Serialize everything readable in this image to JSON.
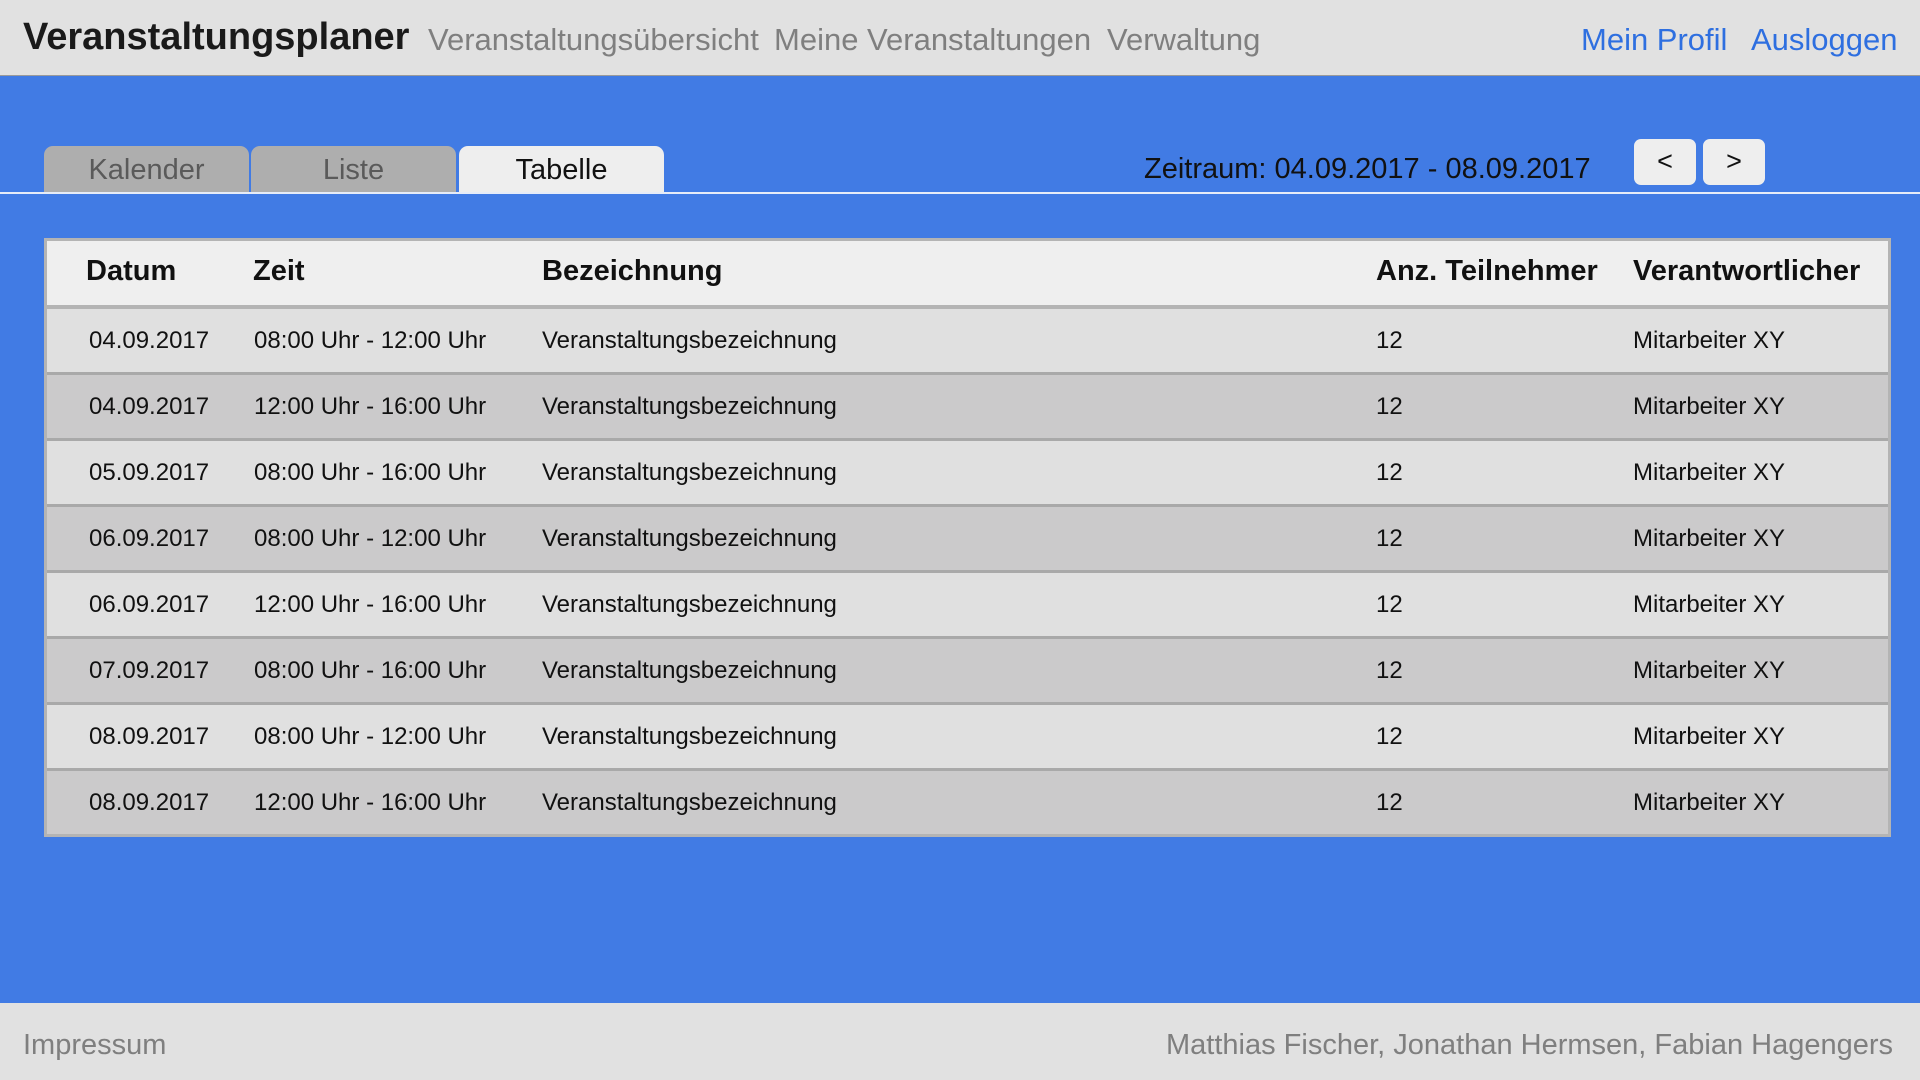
{
  "header": {
    "brand": "Veranstaltungsplaner",
    "nav": [
      "Veranstaltungsübersicht",
      "Meine Veranstaltungen",
      "Verwaltung"
    ],
    "profile": "Mein Profil",
    "logout": "Ausloggen"
  },
  "views": {
    "tabs": [
      "Kalender",
      "Liste",
      "Tabelle"
    ],
    "active": "Tabelle",
    "period": "Zeitraum: 04.09.2017 - 08.09.2017",
    "prev": "<",
    "next": ">"
  },
  "table": {
    "columns": [
      "Datum",
      "Zeit",
      "Bezeichnung",
      "Anz. Teilnehmer",
      "Verantwortlicher"
    ],
    "rows": [
      [
        "04.09.2017",
        "08:00 Uhr - 12:00 Uhr",
        "Veranstaltungsbezeichnung",
        "12",
        "Mitarbeiter XY"
      ],
      [
        "04.09.2017",
        "12:00 Uhr - 16:00 Uhr",
        "Veranstaltungsbezeichnung",
        "12",
        "Mitarbeiter XY"
      ],
      [
        "05.09.2017",
        "08:00 Uhr - 16:00 Uhr",
        "Veranstaltungsbezeichnung",
        "12",
        "Mitarbeiter XY"
      ],
      [
        "06.09.2017",
        "08:00 Uhr - 12:00 Uhr",
        "Veranstaltungsbezeichnung",
        "12",
        "Mitarbeiter XY"
      ],
      [
        "06.09.2017",
        "12:00 Uhr - 16:00 Uhr",
        "Veranstaltungsbezeichnung",
        "12",
        "Mitarbeiter XY"
      ],
      [
        "07.09.2017",
        "08:00 Uhr - 16:00 Uhr",
        "Veranstaltungsbezeichnung",
        "12",
        "Mitarbeiter XY"
      ],
      [
        "08.09.2017",
        "08:00 Uhr - 12:00 Uhr",
        "Veranstaltungsbezeichnung",
        "12",
        "Mitarbeiter XY"
      ],
      [
        "08.09.2017",
        "12:00 Uhr - 16:00 Uhr",
        "Veranstaltungsbezeichnung",
        "12",
        "Mitarbeiter XY"
      ]
    ]
  },
  "footer": {
    "impressum": "Impressum",
    "authors": "Matthias Fischer, Jonathan Hermsen, Fabian Hagengers"
  },
  "colors": {
    "background": "#417be4",
    "header": "#e1e1e1",
    "link": "#2e6fe0",
    "row_odd": "#e0e0e0",
    "row_even": "#cbcacb"
  }
}
